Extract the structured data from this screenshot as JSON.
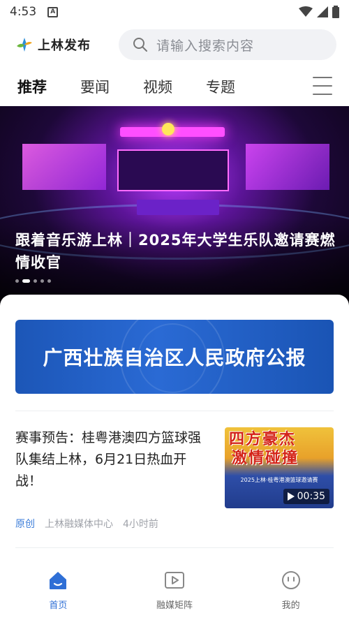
{
  "status_bar": {
    "time": "4:53",
    "notification_icon": "a-icon"
  },
  "header": {
    "app_name": "上林发布",
    "search_placeholder": "请输入搜索内容"
  },
  "tabs": [
    {
      "label": "推荐",
      "active": true
    },
    {
      "label": "要闻",
      "active": false
    },
    {
      "label": "视频",
      "active": false
    },
    {
      "label": "专题",
      "active": false
    }
  ],
  "hero": {
    "title": "跟着音乐游上林｜2025年大学生乐队邀请赛燃情收官",
    "slide_count": 5,
    "active_slide": 2
  },
  "ad_banner": {
    "text": "广西壮族自治区人民政府公报"
  },
  "article": {
    "title": "赛事预告：桂粤港澳四方篮球强队集结上林，6月21日热血开战！",
    "tag": "原创",
    "source": "上林融媒体中心",
    "time_ago": "4小时前",
    "thumbnail": {
      "line1": "四方豪杰",
      "line2": "激情碰撞",
      "subtitle": "2025上林·桂粤港澳篮球邀请赛",
      "duration": "00:35"
    }
  },
  "bottom_nav": [
    {
      "label": "首页",
      "icon": "home-icon",
      "active": true
    },
    {
      "label": "融媒矩阵",
      "icon": "video-play-icon",
      "active": false
    },
    {
      "label": "我的",
      "icon": "smiley-face-icon",
      "active": false
    }
  ],
  "colors": {
    "accent": "#2f6fd6",
    "tag_blue": "#3c7dd9",
    "banner_blue": "#2a6ad4"
  }
}
